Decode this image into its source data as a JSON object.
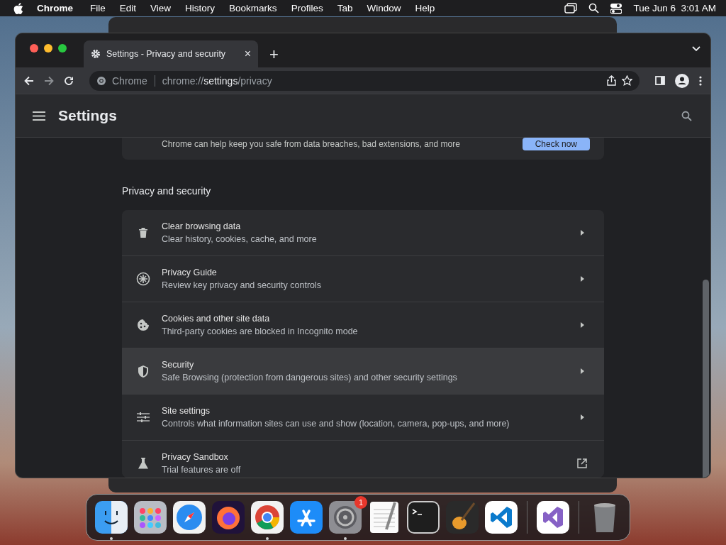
{
  "menubar": {
    "app": "Chrome",
    "menus": [
      "File",
      "Edit",
      "View",
      "History",
      "Bookmarks",
      "Profiles",
      "Tab",
      "Window",
      "Help"
    ],
    "clock": "Tue Jun 6  3:01 AM"
  },
  "tab": {
    "title": "Settings - Privacy and security",
    "close": "×",
    "new_tab": "+"
  },
  "toolbar": {
    "site": "Chrome",
    "url_prefix": "chrome://",
    "url_host": "settings",
    "url_path": "/privacy"
  },
  "header": {
    "title": "Settings"
  },
  "safety_card": {
    "text": "Chrome can help keep you safe from data breaches, bad extensions, and more",
    "button": "Check now"
  },
  "section": {
    "title": "Privacy and security",
    "rows": [
      {
        "kind": "arrow",
        "title": "Clear browsing data",
        "subtitle": "Clear history, cookies, cache, and more",
        "hovered": false
      },
      {
        "kind": "arrow",
        "title": "Privacy Guide",
        "subtitle": "Review key privacy and security controls",
        "hovered": false
      },
      {
        "kind": "arrow",
        "title": "Cookies and other site data",
        "subtitle": "Third-party cookies are blocked in Incognito mode",
        "hovered": false
      },
      {
        "kind": "arrow",
        "title": "Security",
        "subtitle": "Safe Browsing (protection from dangerous sites) and other security settings",
        "hovered": true
      },
      {
        "kind": "arrow",
        "title": "Site settings",
        "subtitle": "Controls what information sites can use and show (location, camera, pop-ups, and more)",
        "hovered": false
      },
      {
        "kind": "external",
        "title": "Privacy Sandbox",
        "subtitle": "Trial features are off",
        "hovered": false
      }
    ]
  },
  "dock": [
    {
      "kind": "app",
      "running": true
    },
    {
      "kind": "app",
      "running": false
    },
    {
      "kind": "app",
      "running": false
    },
    {
      "kind": "app",
      "running": false
    },
    {
      "kind": "app",
      "running": true
    },
    {
      "kind": "app",
      "running": false
    },
    {
      "kind": "app",
      "running": true,
      "badge": "1"
    },
    {
      "kind": "app",
      "running": false
    },
    {
      "kind": "app",
      "running": false
    },
    {
      "kind": "app",
      "running": false
    },
    {
      "kind": "app",
      "running": false
    },
    {
      "kind": "separator"
    },
    {
      "kind": "app",
      "running": false
    },
    {
      "kind": "separator"
    },
    {
      "kind": "trash",
      "running": false
    }
  ]
}
